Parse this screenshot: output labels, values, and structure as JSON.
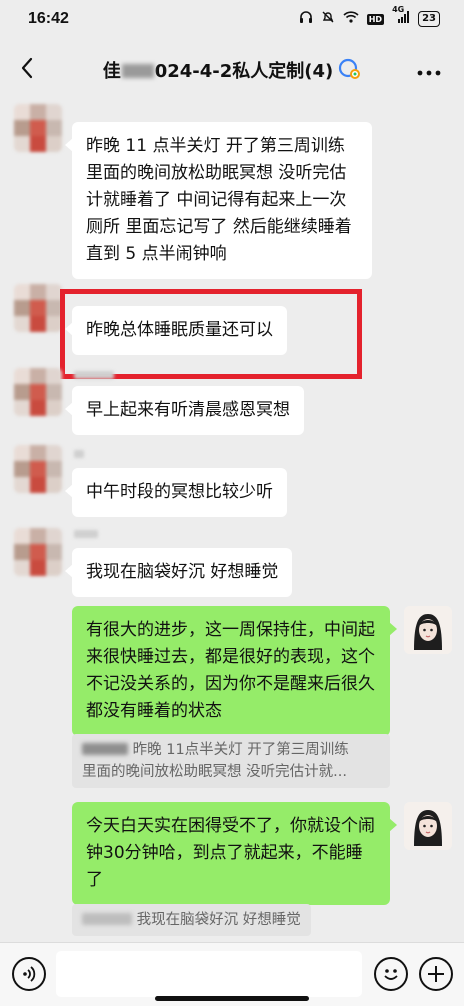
{
  "status_bar": {
    "time": "16:42",
    "network": "4G",
    "hd_label": "HD",
    "battery": "23"
  },
  "header": {
    "title_prefix": "佳",
    "title_suffix": "024-4-2私人定制(4)"
  },
  "messages": [
    {
      "id": "m1",
      "side": "left",
      "text": "昨晚 11 点半关灯  开了第三周训练里面的晚间放松助眠冥想  没听完估计就睡着了  中间记得有起来上一次厕所  里面忘记写了  然后能继续睡着  直到 5 点半闹钟响"
    },
    {
      "id": "m2",
      "side": "left",
      "text": "昨晚总体睡眠质量还可以",
      "highlighted": true
    },
    {
      "id": "m3",
      "side": "left",
      "text": "早上起来有听清晨感恩冥想"
    },
    {
      "id": "m4",
      "side": "left",
      "text": "中午时段的冥想比较少听"
    },
    {
      "id": "m5",
      "side": "left",
      "text": "我现在脑袋好沉  好想睡觉"
    },
    {
      "id": "m6",
      "side": "right",
      "text": "有很大的进步，这一周保持住，中间起来很快睡过去，都是很好的表现，这个不记没关系的，因为你不是醒来后很久都没有睡着的状态"
    },
    {
      "id": "m7",
      "side": "right",
      "text": "今天白天实在困得受不了，你就设个闹钟30分钟哈，到点了就起来，不能睡了"
    }
  ],
  "quotes": {
    "q1_line1": "昨晚 11点半关灯  开了第三周训练",
    "q1_line2": "里面的晚间放松助眠冥想  没听完估计就...",
    "q2": "我现在脑袋好沉  好想睡觉"
  },
  "input": {
    "placeholder": ""
  },
  "colors": {
    "background": "#ededed",
    "bubble_self": "#95ec69",
    "bubble_other": "#ffffff",
    "highlight": "#e4222d"
  }
}
